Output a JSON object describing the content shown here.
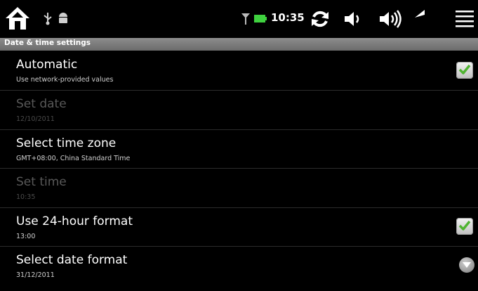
{
  "status_bar": {
    "time": "10:35",
    "icons": [
      "home-icon",
      "usb-icon",
      "android-debug-icon",
      "signal-icon",
      "battery-icon",
      "refresh-icon",
      "volume-down-icon",
      "volume-up-icon",
      "back-icon",
      "menu-icon"
    ]
  },
  "section": {
    "title": "Date & time settings"
  },
  "settings": [
    {
      "title": "Automatic",
      "summary": "Use network-provided values",
      "enabled": true,
      "widget": "checkbox",
      "checked": true
    },
    {
      "title": "Set date",
      "summary": "12/10/2011",
      "enabled": false,
      "widget": "none"
    },
    {
      "title": "Select time zone",
      "summary": "GMT+08:00, China Standard Time",
      "enabled": true,
      "widget": "none"
    },
    {
      "title": "Set time",
      "summary": "10:35",
      "enabled": false,
      "widget": "none"
    },
    {
      "title": "Use 24-hour format",
      "summary": "13:00",
      "enabled": true,
      "widget": "checkbox",
      "checked": true
    },
    {
      "title": "Select date format",
      "summary": "31/12/2011",
      "enabled": true,
      "widget": "dropdown"
    }
  ],
  "colors": {
    "background": "#000000",
    "header": "#7a7a7a",
    "check_green": "#4fb431",
    "battery_green": "#3fd13f",
    "disabled_text": "#595959"
  }
}
